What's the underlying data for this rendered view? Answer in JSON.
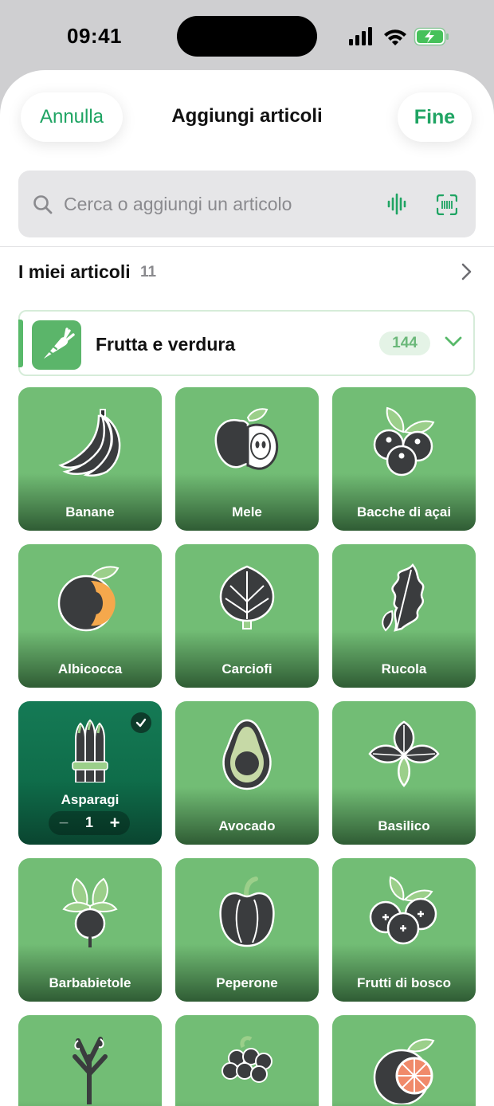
{
  "status": {
    "time": "09:41"
  },
  "header": {
    "cancel": "Annulla",
    "title": "Aggiungi articoli",
    "done": "Fine"
  },
  "search": {
    "placeholder": "Cerca o aggiungi un articolo"
  },
  "my_items": {
    "label": "I miei articoli",
    "count": "11"
  },
  "category": {
    "label": "Frutta e verdura",
    "count": "144"
  },
  "colors": {
    "accent": "#1fa463",
    "tile": "#72bd75",
    "selected_tile": "#137554"
  },
  "items": [
    {
      "label": "Banane",
      "icon": "banana-icon"
    },
    {
      "label": "Mele",
      "icon": "apple-icon"
    },
    {
      "label": "Bacche di açai",
      "icon": "acai-berries-icon"
    },
    {
      "label": "Albicocca",
      "icon": "apricot-icon"
    },
    {
      "label": "Carciofi",
      "icon": "artichoke-icon"
    },
    {
      "label": "Rucola",
      "icon": "arugula-icon"
    },
    {
      "label": "Asparagi",
      "icon": "asparagus-icon",
      "selected": true,
      "quantity": "1"
    },
    {
      "label": "Avocado",
      "icon": "avocado-icon"
    },
    {
      "label": "Basilico",
      "icon": "basil-icon"
    },
    {
      "label": "Barbabietole",
      "icon": "beetroot-icon"
    },
    {
      "label": "Peperone",
      "icon": "bell-pepper-icon"
    },
    {
      "label": "Frutti di bosco",
      "icon": "berries-icon"
    },
    {
      "label": "",
      "icon": "herb-icon"
    },
    {
      "label": "",
      "icon": "blackberry-icon"
    },
    {
      "label": "",
      "icon": "grapefruit-icon"
    }
  ]
}
